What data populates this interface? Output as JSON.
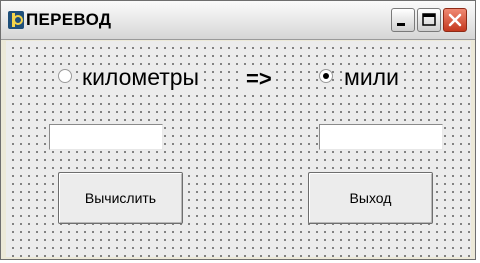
{
  "window": {
    "title": "ПЕРЕВОД",
    "icons": {
      "app": "delphi-app-icon",
      "minimize": "minimize-icon",
      "maximize": "maximize-icon",
      "close": "close-icon"
    }
  },
  "form": {
    "source_option": {
      "label": "километры",
      "selected": false
    },
    "arrow": "=>",
    "target_option": {
      "label": "мили",
      "selected": true
    },
    "input_value": "",
    "output_value": "",
    "calculate_label": "Вычислить",
    "exit_label": "Выход"
  },
  "colors": {
    "accent_close": "#c4381e",
    "dialog_bg": "#ececec"
  }
}
